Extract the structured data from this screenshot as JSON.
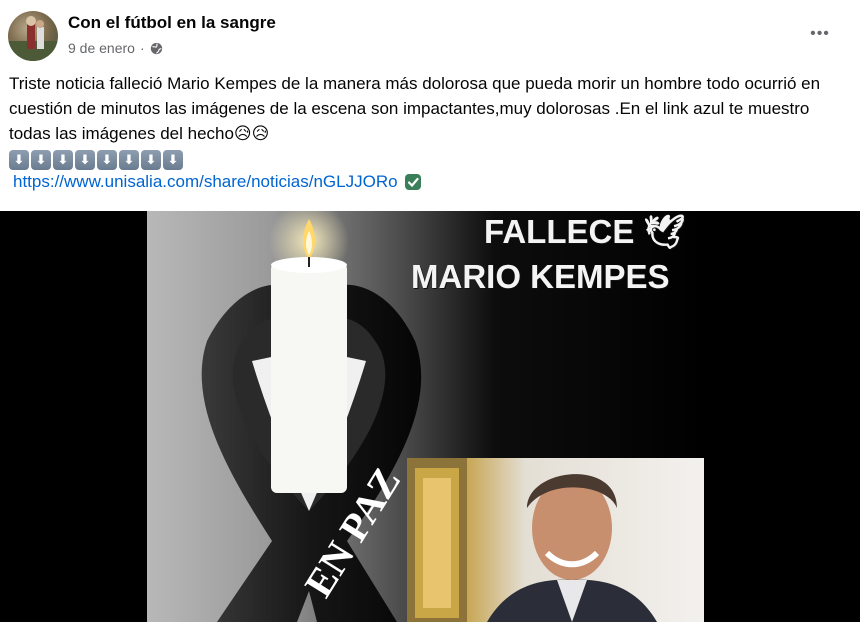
{
  "post": {
    "page_name": "Con el fútbol en la sangre",
    "date": "9 de enero",
    "separator": "·",
    "more_label": "•••",
    "text": "Triste noticia falleció Mario Kempes de la manera más dolorosa que pueda morir un hombre todo ocurrió en cuestión de minutos las imágenes de la escena son impactantes,muy dolorosas .En el link azul te muestro todas las imágenes del hecho😥😥",
    "arrows": [
      "⬇",
      "⬇",
      "⬇",
      "⬇",
      "⬇",
      "⬇",
      "⬇",
      "⬇"
    ],
    "link": "https://www.unisalia.com/share/noticias/nGLJJORo"
  },
  "image": {
    "headline_line1": "FALLECE 🕊",
    "headline_line2": "MARIO KEMPES",
    "ribbon_text": "EN PAZ"
  },
  "colors": {
    "link": "#0064d1",
    "meta_text": "#65676b",
    "verified_badge": "#3b7f5a"
  },
  "icons": [
    "globe-icon",
    "more-icon",
    "down-arrow-icon",
    "verified-check-icon",
    "dove-icon",
    "candle-icon"
  ]
}
